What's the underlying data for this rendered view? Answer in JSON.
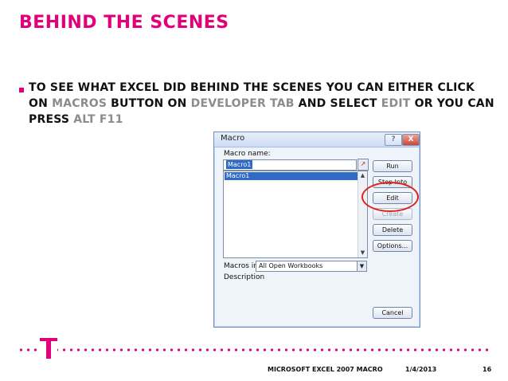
{
  "slide": {
    "title": "BEHIND THE SCENES",
    "bullet": {
      "p1": "TO SEE WHAT EXCEL DID BEHIND THE SCENES YOU CAN EITHER CLICK ON ",
      "h1": "MACROS",
      "p2": " BUTTON ON ",
      "h2": "DEVELOPER TAB",
      "p3": " AND SELECT ",
      "h3": "EDIT",
      "p4": " OR YOU CAN PRESS ",
      "h4": "ALT F11"
    }
  },
  "dialog": {
    "title": "Macro",
    "help_button": "?",
    "close_button": "X",
    "macro_name_label": "Macro name:",
    "macro_name_value": "Macro1",
    "list_items": [
      "Macro1"
    ],
    "macros_in_label": "Macros in:",
    "macros_in_value": "All Open Workbooks",
    "description_label": "Description",
    "buttons": {
      "run": "Run",
      "step_into": "Step Into",
      "edit": "Edit",
      "create": "Create",
      "delete": "Delete",
      "options": "Options...",
      "cancel": "Cancel"
    }
  },
  "footer": {
    "title": "MICROSOFT EXCEL 2007 MACRO",
    "date": "1/4/2013",
    "page": "16"
  },
  "colors": {
    "brand": "#E2007A",
    "highlight_text": "#8C8C8C",
    "annotation_circle": "#E02020"
  }
}
